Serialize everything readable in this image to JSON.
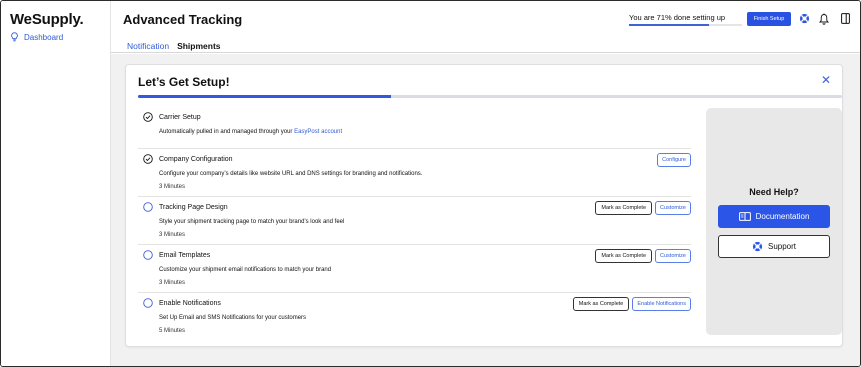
{
  "brand": {
    "logo": "WeSupply."
  },
  "sidebar": {
    "items": [
      {
        "label": "Dashboard",
        "icon": "lightbulb-icon"
      }
    ]
  },
  "header": {
    "title": "Advanced Tracking",
    "tabs": [
      {
        "label": "Notification",
        "active": true
      },
      {
        "label": "Shipments",
        "active": false
      }
    ],
    "setup_progress_text": "You are 71% done setting up",
    "setup_progress": 0.71,
    "finish_button": "Finish Setup",
    "icons": [
      "lifebuoy-icon",
      "bell-icon",
      "sidebar-toggle-icon"
    ]
  },
  "setup": {
    "title": "Let’s Get Setup!",
    "progress": 0.36,
    "steps": [
      {
        "title": "Carrier Setup",
        "desc": "Automatically pulled in and managed through your ",
        "link": "EasyPost account",
        "completed": true
      },
      {
        "title": "Company Configuration",
        "desc": "Configure your company’s details like website URL and DNS settings for branding and notifications.",
        "time": "3 Minutes",
        "completed": true,
        "actions": {
          "configure": "Configure"
        }
      },
      {
        "title": "Tracking Page Design",
        "desc": "Style your shipment tracking page to match your brand’s look and feel",
        "time": "3 Minutes",
        "completed": false,
        "actions": {
          "mark": "Mark as Complete",
          "primary": "Customize"
        }
      },
      {
        "title": "Email Templates",
        "desc": "Customize your shipment email notifications to match your brand",
        "time": "3 Minutes",
        "completed": false,
        "actions": {
          "mark": "Mark as Complete",
          "primary": "Customize"
        }
      },
      {
        "title": "Enable Notifications",
        "desc": "Set Up Email and SMS Notifications for your customers",
        "time": "5 Minutes",
        "completed": false,
        "actions": {
          "mark": "Mark as Complete",
          "primary": "Enable Notifications"
        }
      }
    ]
  },
  "help": {
    "title": "Need Help?",
    "documentation": "Documentation",
    "support": "Support"
  },
  "colors": {
    "accent": "#2b55e6",
    "link": "#2f5bd8",
    "background": "#f1f1f1"
  }
}
